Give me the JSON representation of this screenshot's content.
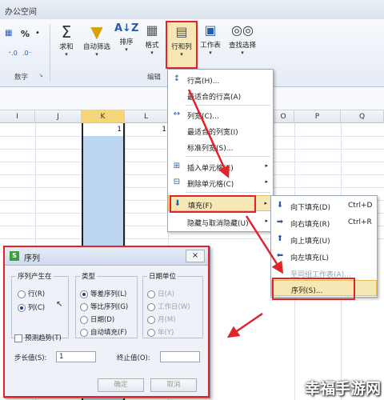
{
  "app_title": "办公空间",
  "ribbon": {
    "number_group_label": "数字",
    "edit_group_label": "编辑",
    "percent_symbol": "%",
    "buttons": {
      "sum": "求和",
      "autofilter": "自动筛选",
      "sort": "排序",
      "format": "格式",
      "rowcol": "行和列",
      "worksheet": "工作表",
      "find": "查找选择"
    }
  },
  "columns": [
    "I",
    "J",
    "K",
    "L",
    "O",
    "P",
    "Q"
  ],
  "cell_values": {
    "k1": "1",
    "l1": "1"
  },
  "menu": {
    "items": [
      {
        "label": "行高(H)..."
      },
      {
        "label": "最适合的行高(A)"
      },
      {
        "label": "列宽(C)..."
      },
      {
        "label": "最适合的列宽(I)"
      },
      {
        "label": "标准列宽(S)..."
      },
      {
        "label": "插入单元格(E)"
      },
      {
        "label": "删除单元格(C)"
      },
      {
        "label": "填充(F)"
      },
      {
        "label": "隐藏与取消隐藏(U)"
      }
    ]
  },
  "submenu": {
    "items": [
      {
        "label": "向下填充(D)",
        "shortcut": "Ctrl+D"
      },
      {
        "label": "向右填充(R)",
        "shortcut": "Ctrl+R"
      },
      {
        "label": "向上填充(U)",
        "shortcut": ""
      },
      {
        "label": "向左填充(L)",
        "shortcut": ""
      },
      {
        "label": "至同组工作表(A)...",
        "shortcut": ""
      },
      {
        "label": "序列(S)...",
        "shortcut": ""
      }
    ]
  },
  "dialog": {
    "title": "序列",
    "close": "×",
    "series_in_label": "序列产生在",
    "series_in_options": [
      "行(R)",
      "列(C)"
    ],
    "series_in_selected": "列(C)",
    "type_label": "类型",
    "type_options": [
      "等差序列(L)",
      "等比序列(G)",
      "日期(D)",
      "自动填充(F)"
    ],
    "type_selected": "等差序列(L)",
    "date_unit_label": "日期单位",
    "date_unit_options": [
      "日(A)",
      "工作日(W)",
      "月(M)",
      "年(Y)"
    ],
    "trend_label": "预测趋势(T)",
    "step_label": "步长值(S):",
    "step_value": "1",
    "stop_label": "终止值(O):",
    "stop_value": "",
    "ok": "确定",
    "cancel": "取消"
  },
  "watermark": "幸福手游网",
  "colors": {
    "highlight_red": "#e0242a",
    "selected_column": "#bcd6f0",
    "menu_hover": "#f7e7b5"
  }
}
